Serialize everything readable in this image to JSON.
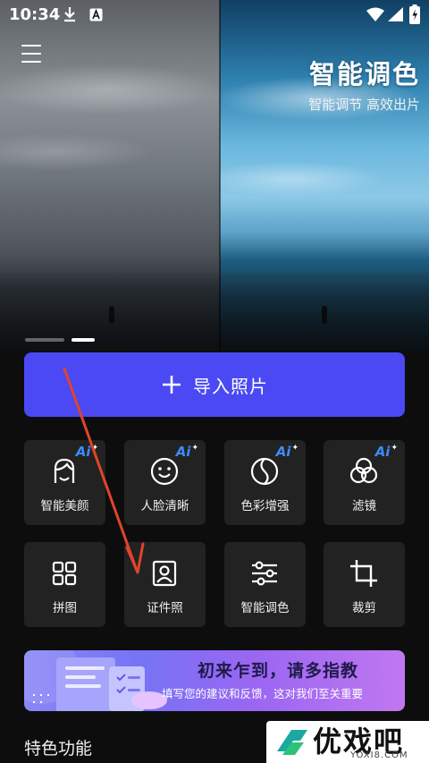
{
  "status_bar": {
    "time": "10:34",
    "icons": [
      "download-icon",
      "a-icon",
      "wifi-icon",
      "signal-icon",
      "battery-charging-icon"
    ]
  },
  "hero": {
    "title": "智能调色",
    "subtitle": "智能调节 高效出片",
    "carousel_pages": 2,
    "carousel_active_index": 1
  },
  "import_button": {
    "icon": "plus-icon",
    "label": "导入照片"
  },
  "ai_badge": "Ai",
  "tools": [
    {
      "label": "智能美颜",
      "icon": "face-outline-icon",
      "ai": true
    },
    {
      "label": "人脸清晰",
      "icon": "smiley-face-icon",
      "ai": true
    },
    {
      "label": "色彩增强",
      "icon": "yin-yang-icon",
      "ai": true
    },
    {
      "label": "滤镜",
      "icon": "overlapping-circles-icon",
      "ai": true
    },
    {
      "label": "拼图",
      "icon": "grid-icon",
      "ai": false
    },
    {
      "label": "证件照",
      "icon": "id-photo-icon",
      "ai": false
    },
    {
      "label": "智能调色",
      "icon": "sliders-icon",
      "ai": false
    },
    {
      "label": "裁剪",
      "icon": "crop-icon",
      "ai": false
    }
  ],
  "banner": {
    "title": "初来乍到，请多指教",
    "subtitle": "填写您的建议和反馈，这对我们至关重要"
  },
  "section": {
    "title": "特色功能"
  },
  "watermark": {
    "text": "优戏吧",
    "url": "YOXI8.COM"
  },
  "colors": {
    "accent": "#4a49f3",
    "tile_bg": "#222222",
    "ai_badge": "#3d8bff",
    "background": "#0d0d0d",
    "annotation_arrow": "#e0442c"
  }
}
